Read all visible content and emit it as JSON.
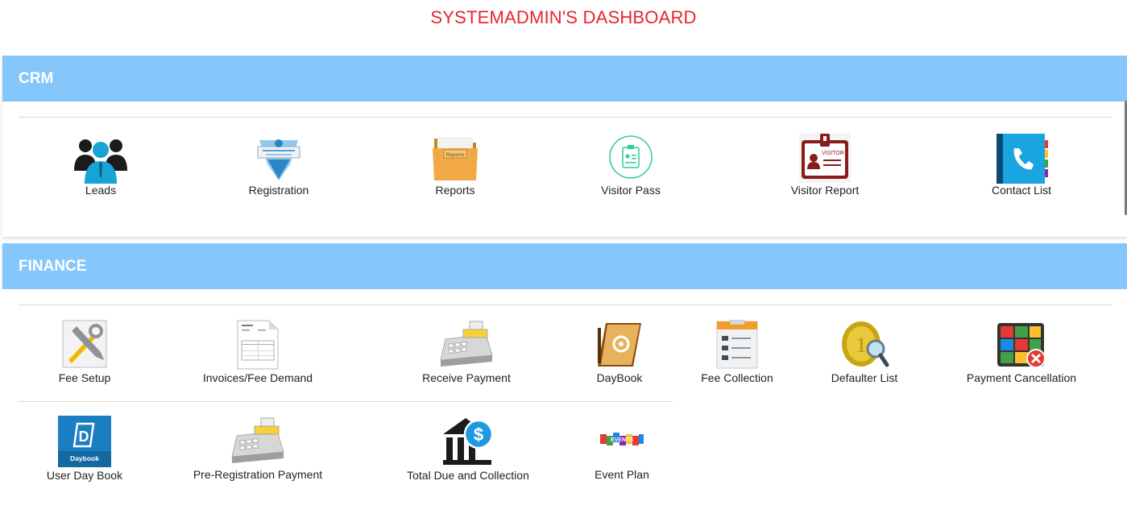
{
  "page": {
    "title": "SYSTEMADMIN'S DASHBOARD"
  },
  "crm": {
    "title": "CRM",
    "items": [
      {
        "label": "Leads",
        "icon": "leads-people-icon"
      },
      {
        "label": "Registration",
        "icon": "registration-badge-icon"
      },
      {
        "label": "Reports",
        "icon": "reports-folder-icon",
        "icon_text": "Reports"
      },
      {
        "label": "Visitor Pass",
        "icon": "visitor-pass-icon"
      },
      {
        "label": "Visitor Report",
        "icon": "visitor-badge-icon",
        "icon_text": "VISITOR"
      },
      {
        "label": "Contact List",
        "icon": "contact-book-icon"
      }
    ]
  },
  "finance": {
    "title": "FINANCE",
    "items": [
      {
        "label": "Fee Setup",
        "icon": "tools-icon"
      },
      {
        "label": "Invoices/Fee Demand",
        "icon": "invoice-document-icon"
      },
      {
        "label": "Receive Payment",
        "icon": "cash-register-icon"
      },
      {
        "label": "DayBook",
        "icon": "address-book-icon"
      },
      {
        "label": "Fee Collection",
        "icon": "form-document-icon"
      },
      {
        "label": "Defaulter List",
        "icon": "coin-magnifier-icon"
      },
      {
        "label": "Payment Cancellation",
        "icon": "payment-cancel-icon"
      },
      {
        "label": "User Day Book",
        "icon": "daybook-app-icon",
        "icon_text": "Daybook"
      },
      {
        "label": "Pre-Registration Payment",
        "icon": "cash-register-icon"
      },
      {
        "label": "Total Due and Collection",
        "icon": "bank-dollar-icon"
      },
      {
        "label": "Event Plan",
        "icon": "events-blocks-icon",
        "icon_text": "EVENTS"
      }
    ]
  },
  "colors": {
    "title": "#e8242c",
    "header_bg": "#85c7fb",
    "header_text": "#ffffff"
  }
}
